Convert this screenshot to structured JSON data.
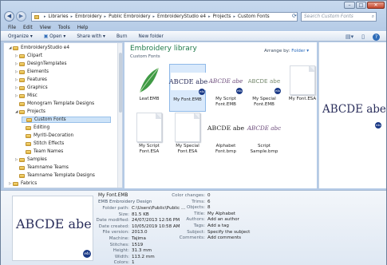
{
  "window": {
    "caption_buttons": [
      "–",
      "□",
      "✕"
    ]
  },
  "address": {
    "crumbs": [
      "Libraries",
      "Embroidery",
      "Public Embroidery",
      "EmbroideryStudio e4",
      "Projects",
      "Custom Fonts"
    ],
    "search_placeholder": "Search Custom Fonts"
  },
  "menu": [
    "File",
    "Edit",
    "View",
    "Tools",
    "Help"
  ],
  "toolbar": {
    "organize": "Organize ▾",
    "open": "Open ▾",
    "share": "Share with ▾",
    "burn": "Burn",
    "new_folder": "New folder"
  },
  "tree": [
    {
      "label": "EmbroideryStudio e4",
      "indent": 0,
      "arrow": "◢"
    },
    {
      "label": "Clipart",
      "indent": 1,
      "arrow": "▷"
    },
    {
      "label": "DesignTemplates",
      "indent": 1,
      "arrow": "▷"
    },
    {
      "label": "Elements",
      "indent": 1,
      "arrow": "▷"
    },
    {
      "label": "Features",
      "indent": 1,
      "arrow": "▷"
    },
    {
      "label": "Graphics",
      "indent": 1,
      "arrow": "▷"
    },
    {
      "label": "Misc",
      "indent": 1,
      "arrow": "▷"
    },
    {
      "label": "Monogram Template Designs",
      "indent": 1,
      "arrow": ""
    },
    {
      "label": "Projects",
      "indent": 1,
      "arrow": "◢"
    },
    {
      "label": "Custom Fonts",
      "indent": 2,
      "arrow": "",
      "selected": true
    },
    {
      "label": "Editing",
      "indent": 2,
      "arrow": ""
    },
    {
      "label": "Myriti-Decoration",
      "indent": 2,
      "arrow": ""
    },
    {
      "label": "Stitch Effects",
      "indent": 2,
      "arrow": ""
    },
    {
      "label": "Team Names",
      "indent": 2,
      "arrow": ""
    },
    {
      "label": "Samples",
      "indent": 1,
      "arrow": "▷"
    },
    {
      "label": "Teamname Teams",
      "indent": 1,
      "arrow": ""
    },
    {
      "label": "Teamname Template Designs",
      "indent": 1,
      "arrow": ""
    },
    {
      "label": "Fabrics",
      "indent": 0,
      "arrow": "▷"
    }
  ],
  "library": {
    "title": "Embroidery library",
    "subtitle": "Custom Fonts",
    "arrange_label": "Arrange by:",
    "arrange_value": "Folder ▾"
  },
  "files": [
    {
      "name": "Leaf.EMB",
      "kind": "leaf"
    },
    {
      "name": "My Font.EMB",
      "kind": "font",
      "sample": "ABCDE abe",
      "selected": true
    },
    {
      "name": "My Script Font.EMB",
      "kind": "script",
      "sample": "ABCDE abe"
    },
    {
      "name": "My Special Font.EMB",
      "kind": "special",
      "sample": "ABCDE abe"
    },
    {
      "name": "My Font.ESA",
      "kind": "blank"
    },
    {
      "name": "My Script Font.ESA",
      "kind": "blank"
    },
    {
      "name": "My Special Font.ESA",
      "kind": "blank"
    },
    {
      "name": "Alphabet Font.bmp",
      "kind": "bmp",
      "sample": "ABCDE abe"
    },
    {
      "name": "Script Sample.bmp",
      "kind": "bmpscript",
      "sample": "ABCDE abc"
    }
  ],
  "preview": {
    "sample": "ABCDE abe"
  },
  "badge_text": "e4s",
  "details": {
    "name": "My Font.EMB",
    "type": "EMB Embroidery Design",
    "sample": "ABCDE abe",
    "left": [
      {
        "k": "Folder path:",
        "v": "C:\\Users\\Public\\Public ..."
      },
      {
        "k": "Size:",
        "v": "81.5 KB"
      },
      {
        "k": "Date modified:",
        "v": "24/07/2013 12:56 PM"
      },
      {
        "k": "Date created:",
        "v": "10/05/2019 10:58 AM"
      },
      {
        "k": "File version:",
        "v": "2013.0"
      },
      {
        "k": "Machine:",
        "v": "Tajima"
      },
      {
        "k": "Stitches:",
        "v": "1519"
      },
      {
        "k": "Height:",
        "v": "31.3 mm"
      },
      {
        "k": "Width:",
        "v": "113.2 mm"
      },
      {
        "k": "Colors:",
        "v": "1"
      },
      {
        "k": "Colorways:",
        "v": "0"
      }
    ],
    "right": [
      {
        "k": "Color changes:",
        "v": "0"
      },
      {
        "k": "Trims:",
        "v": "6"
      },
      {
        "k": "Objects:",
        "v": "8"
      },
      {
        "k": "Title:",
        "v": "My Alphabet"
      },
      {
        "k": "Authors:",
        "v": "Add an author"
      },
      {
        "k": "Tags:",
        "v": "Add a tag"
      },
      {
        "k": "Subject:",
        "v": "Specify the subject"
      },
      {
        "k": "Comments:",
        "v": "Add comments"
      }
    ]
  },
  "colors": {
    "accent_green": "#1f7a4a",
    "selection": "#cde3f8",
    "thread": "#2b2f5c",
    "badge": "#1b3a86"
  }
}
